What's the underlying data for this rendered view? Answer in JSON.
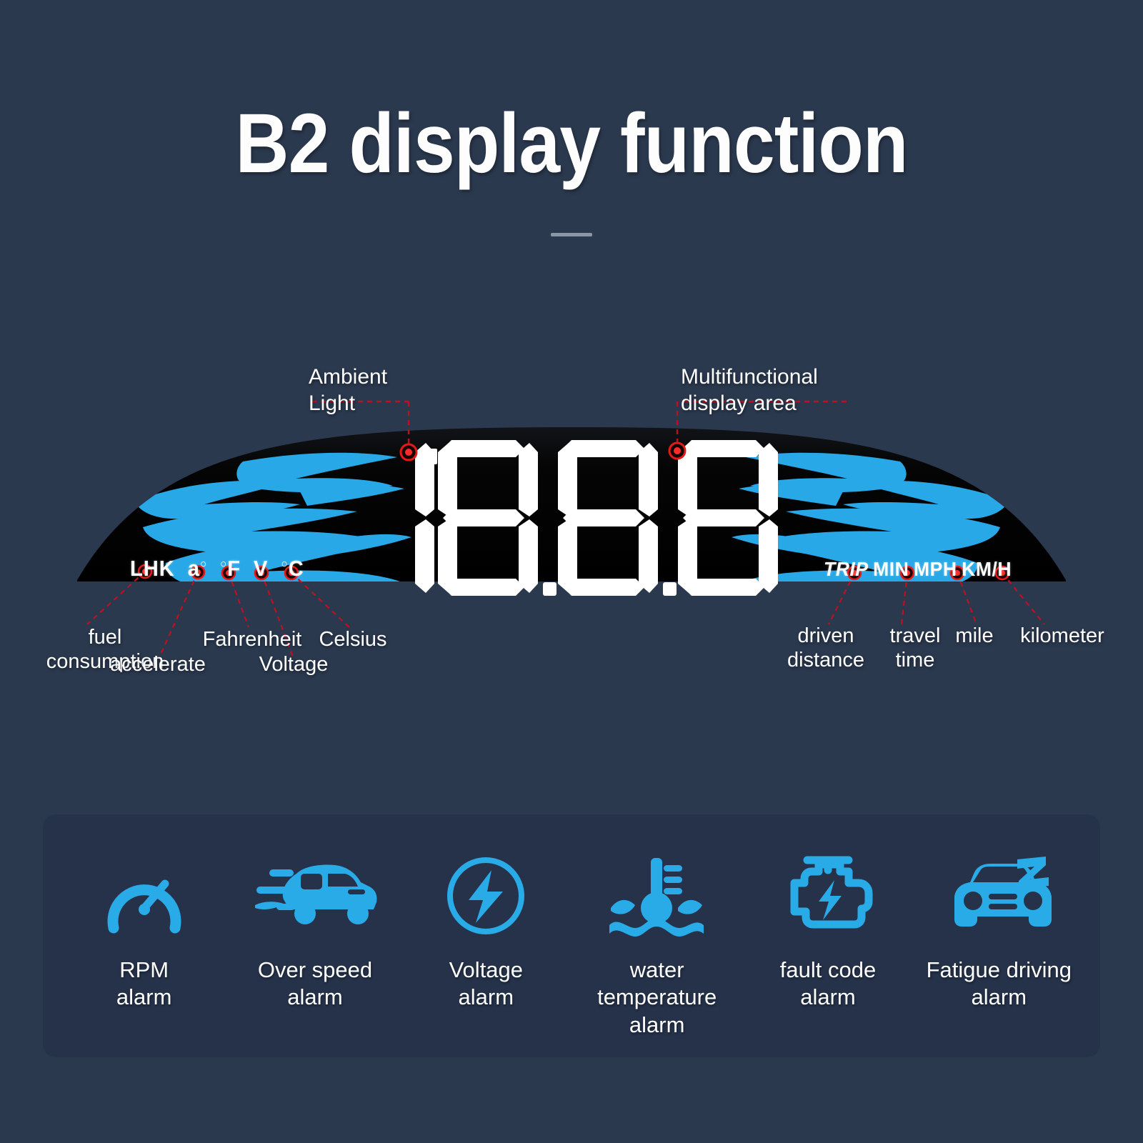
{
  "header": {
    "title": "B2 display function",
    "divider": true
  },
  "device": {
    "display_value": "18.8.8",
    "indicators_left": [
      {
        "label": "LHK",
        "name": "lhk-indicator"
      },
      {
        "label": "a",
        "degree": true,
        "name": "accelerate-indicator"
      },
      {
        "label": "F",
        "degree_before": true,
        "name": "fahrenheit-indicator"
      },
      {
        "label": "V",
        "name": "voltage-indicator"
      },
      {
        "label": "C",
        "degree_before": true,
        "name": "celsius-indicator"
      }
    ],
    "indicators_left_text": "LHK  a°  °F  V  °C",
    "indicators_right": [
      "TRIP",
      "MIN",
      "MPH",
      "KM/H"
    ],
    "colors": {
      "body": "#050505",
      "flame": "#28a8e6",
      "digit": "#ffffff",
      "marker": "#e01515",
      "leader_line": "#c01020"
    }
  },
  "callouts": {
    "top": [
      {
        "id": "ambient-light",
        "line1": "Ambient",
        "line2": "Light"
      },
      {
        "id": "multifunctional-display",
        "line1": "Multifunctional",
        "line2": "display area"
      }
    ],
    "left": [
      {
        "id": "fuel-consumption",
        "text": "fuel\nconsumption"
      },
      {
        "id": "accelerate",
        "text": "accelerate"
      },
      {
        "id": "fahrenheit",
        "text": "Fahrenheit"
      },
      {
        "id": "voltage",
        "text": "Voltage"
      },
      {
        "id": "celsius",
        "text": "Celsius"
      }
    ],
    "right": [
      {
        "id": "driven-distance",
        "text": "driven\ndistance"
      },
      {
        "id": "travel-time",
        "text": "travel\ntime"
      },
      {
        "id": "mile",
        "text": "mile"
      },
      {
        "id": "kilometer",
        "text": "kilometer"
      }
    ]
  },
  "features": [
    {
      "icon": "gauge-icon",
      "label": "RPM\nalarm"
    },
    {
      "icon": "speeding-car-icon",
      "label": "Over speed\nalarm"
    },
    {
      "icon": "bolt-circle-icon",
      "label": "Voltage\nalarm"
    },
    {
      "icon": "thermometer-water-icon",
      "label": "water\ntemperature alarm"
    },
    {
      "icon": "check-engine-icon",
      "label": "fault code\nalarm"
    },
    {
      "icon": "sleeping-car-icon",
      "label": "Fatigue driving\nalarm"
    }
  ],
  "theme": {
    "background": "#2b394f",
    "panel": "#25324a",
    "accent": "#29abe8",
    "text": "#ffffff",
    "divider": "#8b96a6"
  }
}
